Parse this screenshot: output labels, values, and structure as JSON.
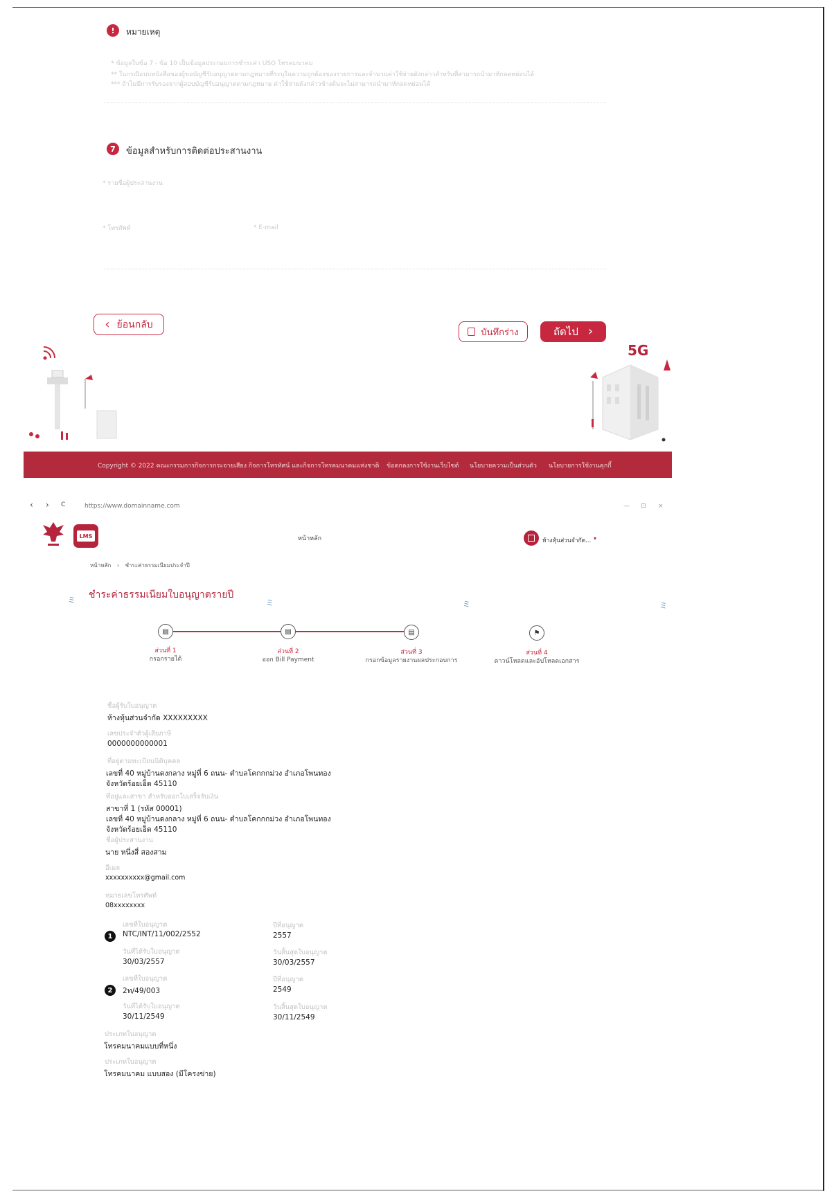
{
  "notes_section": {
    "title": "หมายเหตุ",
    "badge": "!",
    "lines": [
      "* ข้อมูลในข้อ 7 - ข้อ 10 เป็นข้อมูลประกอบการชำระค่า USO โทรคมนาคม",
      "** ในกรณีแบบหนังสือของผู้ขอบัญชีรับอนุญาตตามกฎหมายที่ระบุในความถูกต้องของรายการและจำนวนค่าใช้จ่ายดังกล่าวสำหรับที่สามารถนำมาหักลดหย่อนได้",
      "*** ถ้าไม่มีการรับรองจากผู้สอบบัญชีรับอนุญาตตามกฎหมาย ค่าใช้จ่ายดังกล่าวข้างต้นจะไม่สามารถนำมาหักลดหย่อนได้"
    ]
  },
  "contact_section": {
    "badge": "7",
    "title": "ข้อมูลสำหรับการติดต่อประสานงาน",
    "name_label": "* รายชื่อผู้ประสานงาน",
    "phone_label": "* โทรศัพท์",
    "email_label": "* E-mail"
  },
  "actions": {
    "back_label": "ย้อนกลับ",
    "draft_label": "บันทึกร่าง",
    "next_label": "ถัดไป"
  },
  "illustration": {
    "badge_5g": "5G"
  },
  "footer": {
    "copyright": "Copyright © 2022 คณะกรรมการกิจการกระจายเสียง กิจการโทรทัศน์ และกิจการโทรคมนาคมแห่งชาติ",
    "links": [
      "ข้อตกลงการใช้งานเว็บไซต์",
      "นโยบายความเป็นส่วนตัว",
      "นโยบายการใช้งานคุกกี้"
    ]
  },
  "browser": {
    "url": "https://www.domainname.com",
    "nav_back": "‹",
    "nav_forward": "›",
    "reload": "C",
    "win_controls": [
      "—",
      "⊡",
      "×"
    ]
  },
  "app_header": {
    "logo_text": "LMS",
    "nav_home": "หน้าหลัก",
    "account_name": "ห้างหุ้นส่วนจำกัด...",
    "account_caret": "▾"
  },
  "breadcrumb": {
    "home": "หน้าหลัก",
    "separator": "›",
    "current": "ชำระค่าธรรมเนียมประจำปี"
  },
  "page_title": "ชำระค่าธรรมเนียมใบอนุญาตรายปี",
  "stepper": {
    "steps": [
      {
        "top": "ส่วนที่ 1",
        "bottom": "กรอกรายได้"
      },
      {
        "top": "ส่วนที่ 2",
        "bottom": "ออก Bill Payment"
      },
      {
        "top": "ส่วนที่ 3",
        "bottom": "กรอกข้อมูลรายงานผลประกอบการ"
      },
      {
        "top": "ส่วนที่ 4",
        "bottom": "ดาวน์โหลดและอัปโหลดเอกสาร"
      }
    ]
  },
  "details": {
    "licensee_label": "ชื่อผู้รับใบอนุญาต",
    "licensee_value": "ห้างหุ้นส่วนจำกัด XXXXXXXXX",
    "taxid_label": "เลขประจำตัวผู้เสียภาษี",
    "taxid_value": "0000000000001",
    "address_label": "ที่อยู่ตามทะเบียนนิติบุคคล",
    "address_line1": "เลขที่ 40 หมู่บ้านดงกลาง หมู่ที่ 6 ถนน- ตำบลโคกกกม่วง อำเภอโพนทอง",
    "address_line2": "จังหวัดร้อยเอ็ด 45110",
    "branch_label": "ที่อยู่และสาขา สำหรับออกใบเสร็จรับเงิน",
    "branch_name": "สาขาที่ 1 (รหัส 00001)",
    "branch_line1": "เลขที่ 40 หมู่บ้านดงกลาง หมู่ที่ 6 ถนน- ตำบลโคกกกม่วง อำเภอโพนทอง",
    "branch_line2": "จังหวัดร้อยเอ็ด 45110",
    "coordinator_label": "ชื่อผู้ประสานงาน",
    "coordinator_value": "นาย หนึ่งสี่ สองสาม",
    "email_label": "อีเมล",
    "email_value": "xxxxxxxxxx@gmail.com",
    "phone_label": "หมายเลขโทรศัพท์",
    "phone_value": "08xxxxxxxx"
  },
  "licenses": [
    {
      "badge": "1",
      "no_label": "เลขที่ใบอนุญาต",
      "no_value": "NTC/INT/11/002/2552",
      "year_label": "ปีที่อนุญาต",
      "year_value": "2557",
      "issue_label": "วันที่ได้รับใบอนุญาต",
      "issue_value": "30/03/2557",
      "expire_label": "วันสิ้นสุดใบอนุญาต",
      "expire_value": "30/03/2557"
    },
    {
      "badge": "2",
      "no_label": "เลขที่ใบอนุญาต",
      "no_value": "2ท/49/003",
      "year_label": "ปีที่อนุญาต",
      "year_value": "2549",
      "issue_label": "วันที่ได้รับใบอนุญาต",
      "issue_value": "30/11/2549",
      "expire_label": "วันสิ้นสุดใบอนุญาต",
      "expire_value": "30/11/2549"
    }
  ],
  "license_types": [
    {
      "label": "ประเภทใบอนุญาต",
      "value": "โทรคมนาคมแบบที่หนึ่ง"
    },
    {
      "label": "ประเภทใบอนุญาต",
      "value": "โทรคมนาคม แบบสอง (มีโครงข่าย)"
    }
  ]
}
